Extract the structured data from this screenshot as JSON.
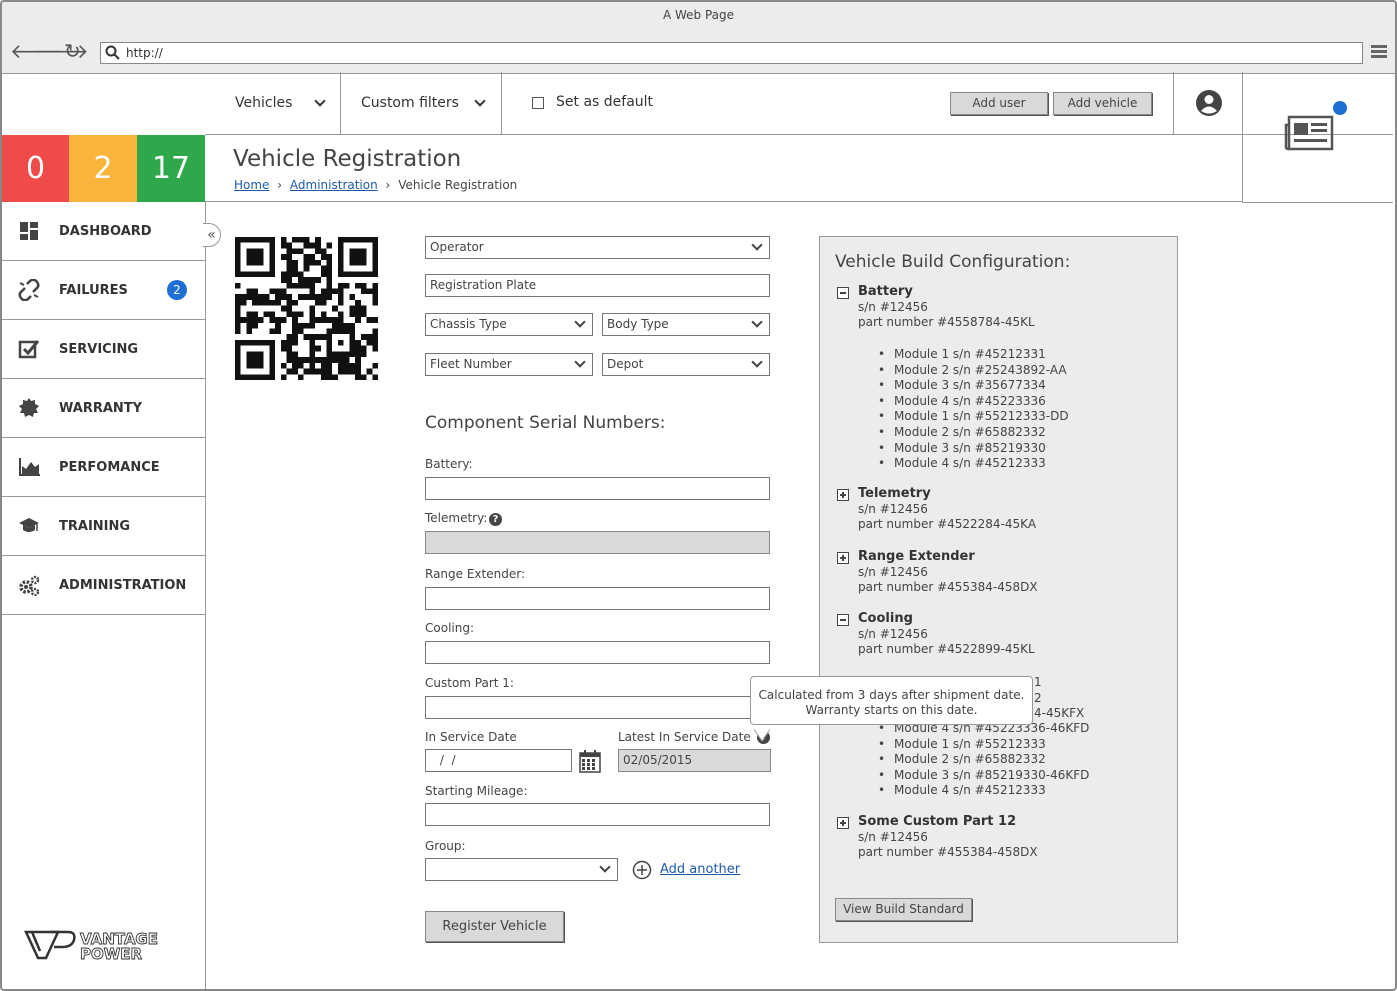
{
  "window": {
    "title": "A Web Page",
    "url": "http://"
  },
  "topbar": {
    "vehicles": "Vehicles",
    "custom_filters": "Custom filters",
    "set_default": "Set as default",
    "add_user": "Add user",
    "add_vehicle": "Add vehicle"
  },
  "stats": [
    {
      "value": "0",
      "color": "#f04b4b"
    },
    {
      "value": "2",
      "color": "#f9b43c"
    },
    {
      "value": "17",
      "color": "#2fa84c"
    }
  ],
  "page": {
    "title": "Vehicle Registration",
    "breadcrumb": [
      "Home",
      "Administration",
      "Vehicle Registration"
    ]
  },
  "sidebar": {
    "items": [
      {
        "label": "DASHBOARD",
        "icon": "dashboard-icon"
      },
      {
        "label": "FAILURES",
        "icon": "broken-link-icon",
        "badge": "2"
      },
      {
        "label": "SERVICING",
        "icon": "checkbox-icon"
      },
      {
        "label": "WARRANTY",
        "icon": "seal-icon"
      },
      {
        "label": "PERFOMANCE",
        "icon": "area-chart-icon"
      },
      {
        "label": "TRAINING",
        "icon": "graduation-cap-icon"
      },
      {
        "label": "ADMINISTRATION",
        "icon": "gears-icon"
      }
    ],
    "logo": "VANTAGE POWER"
  },
  "form": {
    "operator": "Operator",
    "registration_plate": "Registration Plate",
    "chassis_type": "Chassis Type",
    "body_type": "Body Type",
    "fleet_number": "Fleet Number",
    "depot": "Depot",
    "section_title": "Component Serial Numbers:",
    "battery": "Battery:",
    "telemetry": "Telemetry:",
    "range_extender": "Range Extender:",
    "cooling": "Cooling:",
    "custom_part": "Custom Part 1:",
    "in_service_date": "In Service Date",
    "in_service_value": " /  /",
    "latest_in_service_date": "Latest In Service Date",
    "latest_value": "02/05/2015",
    "starting_mileage": "Starting Mileage:",
    "group": "Group:",
    "add_another": "Add another",
    "register": "Register Vehicle"
  },
  "tooltip": {
    "line1": "Calculated from 3 days after shipment date.",
    "line2": "Warranty starts on this date."
  },
  "config": {
    "title": "Vehicle Build Configuration:",
    "battery": {
      "name": "Battery",
      "sn": "s/n #12456",
      "pn": "part number #4558784-45KL",
      "modules": [
        "Module 1 s/n #45212331",
        "Module 2 s/n #25243892-AA",
        "Module 3 s/n #35677334",
        "Module 4 s/n #45223336",
        "Module 1 s/n #55212333-DD",
        "Module 2 s/n #65882332",
        "Module 3 s/n #85219330",
        "Module 4 s/n #45212333"
      ]
    },
    "telemetry": {
      "name": "Telemetry",
      "sn": "s/n #12456",
      "pn": "part number #4522284-45KA"
    },
    "range_extender": {
      "name": "Range Extender",
      "sn": "s/n #12456",
      "pn": "part number #455384-458DX"
    },
    "cooling": {
      "name": "Cooling",
      "sn": "s/n #12456",
      "pn": "part number #4522899-45KL",
      "modules_partial": [
        "1",
        "2",
        "4-45KFX"
      ],
      "modules": [
        "Module 4 s/n #45223336-46KFD",
        "Module 1 s/n #55212333",
        "Module 2 s/n #65882332",
        "Module 3 s/n #85219330-46KFD",
        "Module 4 s/n #45212333"
      ]
    },
    "custom": {
      "name": "Some Custom Part 12",
      "sn": "s/n #12456",
      "pn": "part number #455384-458DX"
    },
    "view_button": "View Build Standard"
  }
}
